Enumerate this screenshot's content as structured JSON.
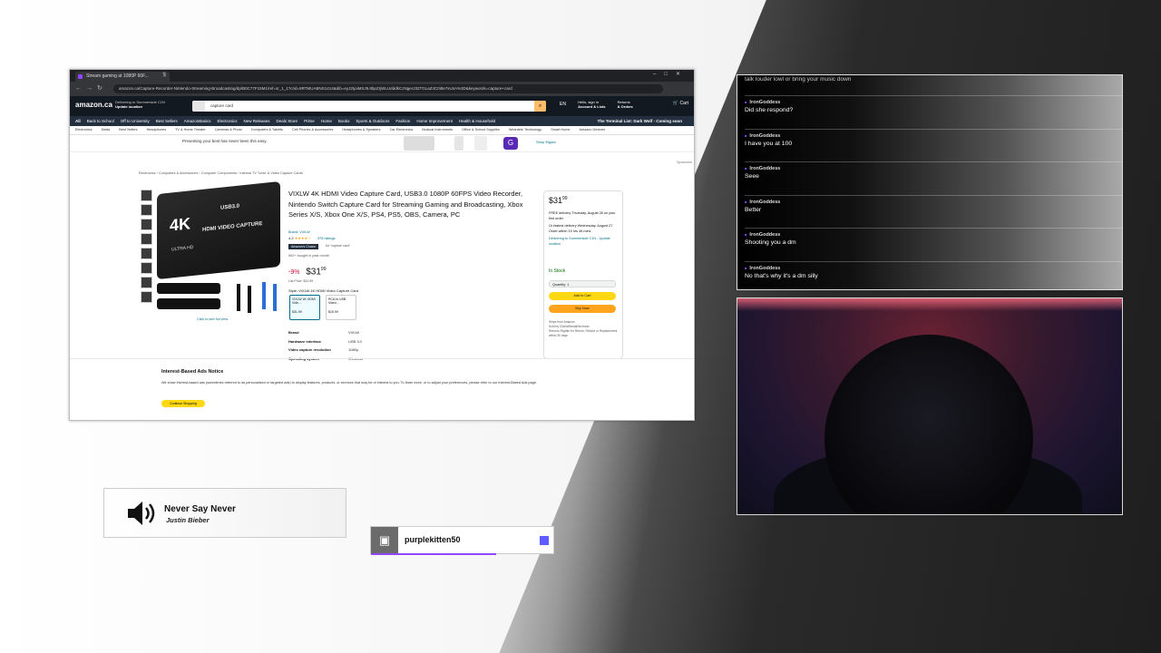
{
  "browser": {
    "tab_title": "Stream gaming at 1080P 60F...",
    "url": "amazon.ca/Capture-Recorder-Nintendo-Streaming-Broadcasting/dp/B0C77F15M1/ref=sr_1_1?crid=8RTMUABNS1414&dib=eyJ2IjoiMSJ9.8bpZrjWLUdddkCzNgerJ32TGLaZ4C0itte7sUsA%3D&keywords=capture+card"
  },
  "amazon": {
    "logo": "amazon.ca",
    "location_line1": "Delivering to Summerside C1N",
    "location_line2": "Update location",
    "search_value": "capture card",
    "lang": "EN",
    "account_line1": "Hello, sign in",
    "account_line2": "Account & Lists",
    "returns_line1": "Returns",
    "returns_line2": "& Orders",
    "cart_label": "Cart",
    "nav_items": [
      "All",
      "Back to School",
      "Off to University",
      "Best Sellers",
      "AmazonBasics",
      "Electronics",
      "New Releases",
      "Deals Store",
      "Prime",
      "Home",
      "Books",
      "Sports & Outdoors",
      "Fashion",
      "Home Improvement",
      "Health & Household"
    ],
    "nav_promo": "The Terminal List: Dark Wolf - Coming soon",
    "sub_nav": [
      "Electronics",
      "Deals",
      "Best Sellers",
      "Headphones",
      "TV & Home Theater",
      "Cameras & Photo",
      "Computers & Tablets",
      "Cell Phones & Accessories",
      "Headphones & Speakers",
      "Car Electronics",
      "Musical Instruments",
      "Office & School Supplies",
      "Wearable Technology",
      "Smart Home",
      "Amazon Devices"
    ],
    "promo_text": "Presenting your best has never been this easy.",
    "promo_link": "Shop Elgato",
    "sponsored": "Sponsored",
    "breadcrumb": "Electronics › Computers & Accessories › Computer Components › Internal TV Tuner & Video Capture Cards"
  },
  "product": {
    "title": "VIXLW 4K HDMI Video Capture Card, USB3.0 1080P 60FPS Video Recorder, Nintendo Switch Capture Card for Streaming Gaming and Broadcasting, Xbox Series X/S, Xbox One X/S, PS4, PS5, OBS, Camera, PC",
    "brand": "Brand: VIXLW",
    "rating": "4.2",
    "stars": "★★★★☆",
    "rating_count": "378 ratings",
    "choice_badge": "Amazon's Choice",
    "choice_for": "for \"capture card\"",
    "bought": "500+ bought in past month",
    "discount": "-9%",
    "price": "$31",
    "price_cents": "99",
    "list_price": "List Price: $34.99",
    "style_label": "Style: VIXLW 4K HDMI Video Capture Card",
    "image_text_4k": "4K",
    "image_text_main": "HDMI VIDEO CAPTURE",
    "image_text_usb": "USB3.0",
    "image_text_uhd": "ULTRA HD",
    "full_view": "Click to see full view",
    "options": [
      {
        "name": "VIXLW 4K HDMI Vide...",
        "price": "$31.99"
      },
      {
        "name": "RCA to USB Video...",
        "price": "$15.99"
      }
    ],
    "specs": [
      {
        "k": "Brand",
        "v": "VIXLW"
      },
      {
        "k": "Hardware interface",
        "v": "USB 3.0"
      },
      {
        "k": "Video capture resolution",
        "v": "1080p"
      },
      {
        "k": "Operating system",
        "v": "Windows"
      }
    ]
  },
  "buybox": {
    "price": "$31",
    "price_cents": "99",
    "delivery": "FREE delivery Thursday, August 28 on your first order",
    "fastest": "Or fastest delivery Wednesday, August 27. Order within 15 hrs 46 mins",
    "deliver_to": "Delivering to Summerside C1N - Update location",
    "stock": "In Stock",
    "quantity": "Quantity: 1",
    "add_to_cart": "Add to Cart",
    "buy_now": "Buy Now",
    "ships_from": "Ships from  Amazon",
    "sold_by": "Sold by  ClicNaRamaElectronic",
    "returns": "Returns  Eligible for Return, Refund or Replacement within 30 days"
  },
  "ads": {
    "title": "Interest-Based Ads Notice",
    "text": "We show interest-based ads (sometimes referred to as personalized or targeted ads) to display features, products, or services that may be of interest to you. To learn more, or to adjust your preferences, please refer to our Interest-Based Ads page.",
    "button": "Continue Shopping"
  },
  "chat": {
    "top_line": "talk louder lowl or bring your music down",
    "messages": [
      {
        "user": "IronGoddess",
        "text": "Did she respond?"
      },
      {
        "user": "IronGoddess",
        "text": "I have you at 100"
      },
      {
        "user": "IronGoddess",
        "text": "Seee"
      },
      {
        "user": "IronGoddess",
        "text": "Better"
      },
      {
        "user": "IronGoddess",
        "text": "Shooting you a dm"
      },
      {
        "user": "IronGoddess",
        "text": "No that's why it's a dm silly"
      }
    ]
  },
  "now_playing": {
    "song": "Never Say Never",
    "artist": "Justin Bieber"
  },
  "follower": {
    "name": "purplekitten50"
  },
  "colors": {
    "twitch_purple": "#9146ff",
    "amazon_dark": "#131921",
    "amazon_yellow": "#ffd814",
    "amazon_orange": "#ffa41c"
  }
}
